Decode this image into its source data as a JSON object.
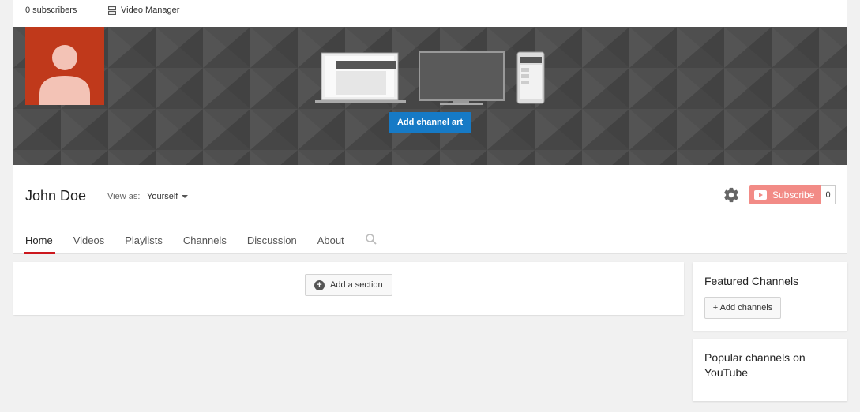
{
  "topbar": {
    "subscribers": "0 subscribers",
    "video_manager": "Video Manager"
  },
  "banner": {
    "add_art_label": "Add channel art",
    "accent_color": "#167ac6",
    "avatar_color": "#c0391b"
  },
  "channel": {
    "name": "John Doe",
    "view_as_label": "View as:",
    "view_as_value": "Yourself"
  },
  "subscribe": {
    "label": "Subscribe",
    "count": "0",
    "color": "#f28b86"
  },
  "tabs": [
    {
      "label": "Home",
      "active": true
    },
    {
      "label": "Videos",
      "active": false
    },
    {
      "label": "Playlists",
      "active": false
    },
    {
      "label": "Channels",
      "active": false
    },
    {
      "label": "Discussion",
      "active": false
    },
    {
      "label": "About",
      "active": false
    }
  ],
  "main": {
    "add_section_label": "Add a section"
  },
  "sidebar": {
    "featured_title": "Featured Channels",
    "add_channels_label": "+ Add channels",
    "popular_title": "Popular channels on YouTube"
  },
  "icons": {
    "video_manager": "video-manager-icon",
    "settings": "gear-icon",
    "youtube": "youtube-play-icon",
    "search": "search-icon",
    "add": "plus-circle-icon"
  }
}
